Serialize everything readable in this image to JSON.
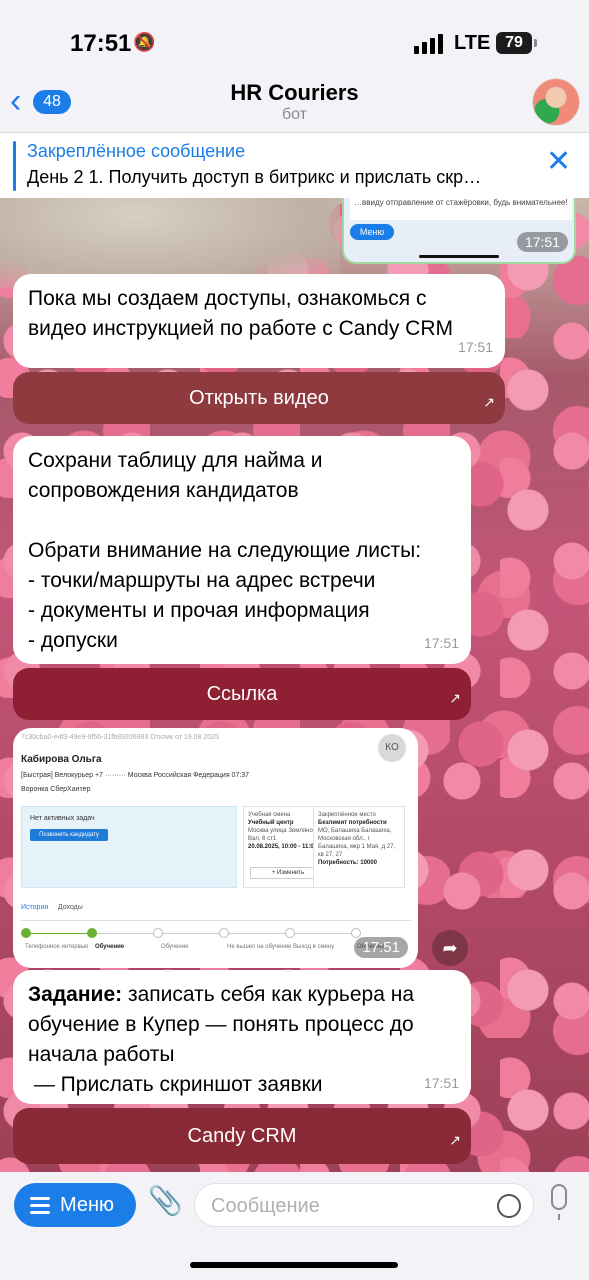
{
  "status": {
    "time": "17:51",
    "network": "LTE",
    "battery": "79"
  },
  "header": {
    "back_count": "48",
    "title": "HR Couriers",
    "subtitle": "бот"
  },
  "pinned": {
    "title": "Закреплённое сообщение",
    "text": "День 2 1. Получить доступ в битрикс и прислать скр…"
  },
  "prev_image": {
    "text": "…ввиду отправление от стажёровки, будь внимательнее!",
    "menu": "Меню",
    "placeholder": "Сообщение",
    "time": "17:51"
  },
  "messages": [
    {
      "text": "Пока мы создаем доступы, ознакомься с видео инструкцией по работе с Candy CRM",
      "time": "17:51",
      "button": "Открыть видео",
      "button_color": "#8e3a3f"
    },
    {
      "text": "Сохрани таблицу для найма и сопровождения кандидатов\n\nОбрати внимание на следующие листы:\n- точки/маршруты на адрес встречи\n- документы и прочая информация\n- допуски",
      "time": "17:51",
      "button": "Ссылка",
      "button_color": "#8f1f33"
    },
    {
      "bold": "Задание:",
      "text": " записать себя как курьера на обучение в Купер — понять процесс до начала работы\n — Прислать скриншот заявки",
      "time": "17:51",
      "button": "Candy CRM",
      "button_color": "#8b2a37"
    }
  ],
  "screenshot": {
    "meta": "7c30cba0-e4f3-49e9-9f56-31fb89206983 Отклик от 19.08.2025",
    "avatar": "КО",
    "name": "Кабирова Ольга",
    "info": "[Быстрая] Велокурьер    +7 ·········    Москва    Российская Федерация    07:37",
    "info2": "Воронка СберХантер",
    "task_label": "Нет активных задач",
    "task_button": "Позвонить кандидату",
    "card1_title": "Учебная смена",
    "card1_name": "Учебный центр",
    "card1_addr": "Москва улица Земляной Вал, 6 ст1",
    "card1_date": "20.08.2025, 10:00 - 11:00",
    "card1_btn": "+ Изменить",
    "card2_title": "Закреплённое место",
    "card2_name": "Безлимит потребности",
    "card2_addr": "МО, Балашиха Балашиха, Московская обл., г Балашиха, мкр 1 Мая, д 27, кв 27, 27",
    "card2_need": "Потребность: 10000",
    "tab1": "История",
    "tab2": "Доходы",
    "steps": [
      "Телефонное интервью",
      "Обучение",
      "Обучение",
      "Не вышел на обучение",
      "Выход в смену",
      "Обучение"
    ],
    "progress_fraction": 0.2,
    "time": "17:51"
  },
  "input": {
    "menu": "Меню",
    "placeholder": "Сообщение"
  },
  "colors": {
    "accent": "#1a7de8",
    "bubble": "#ffffff"
  }
}
